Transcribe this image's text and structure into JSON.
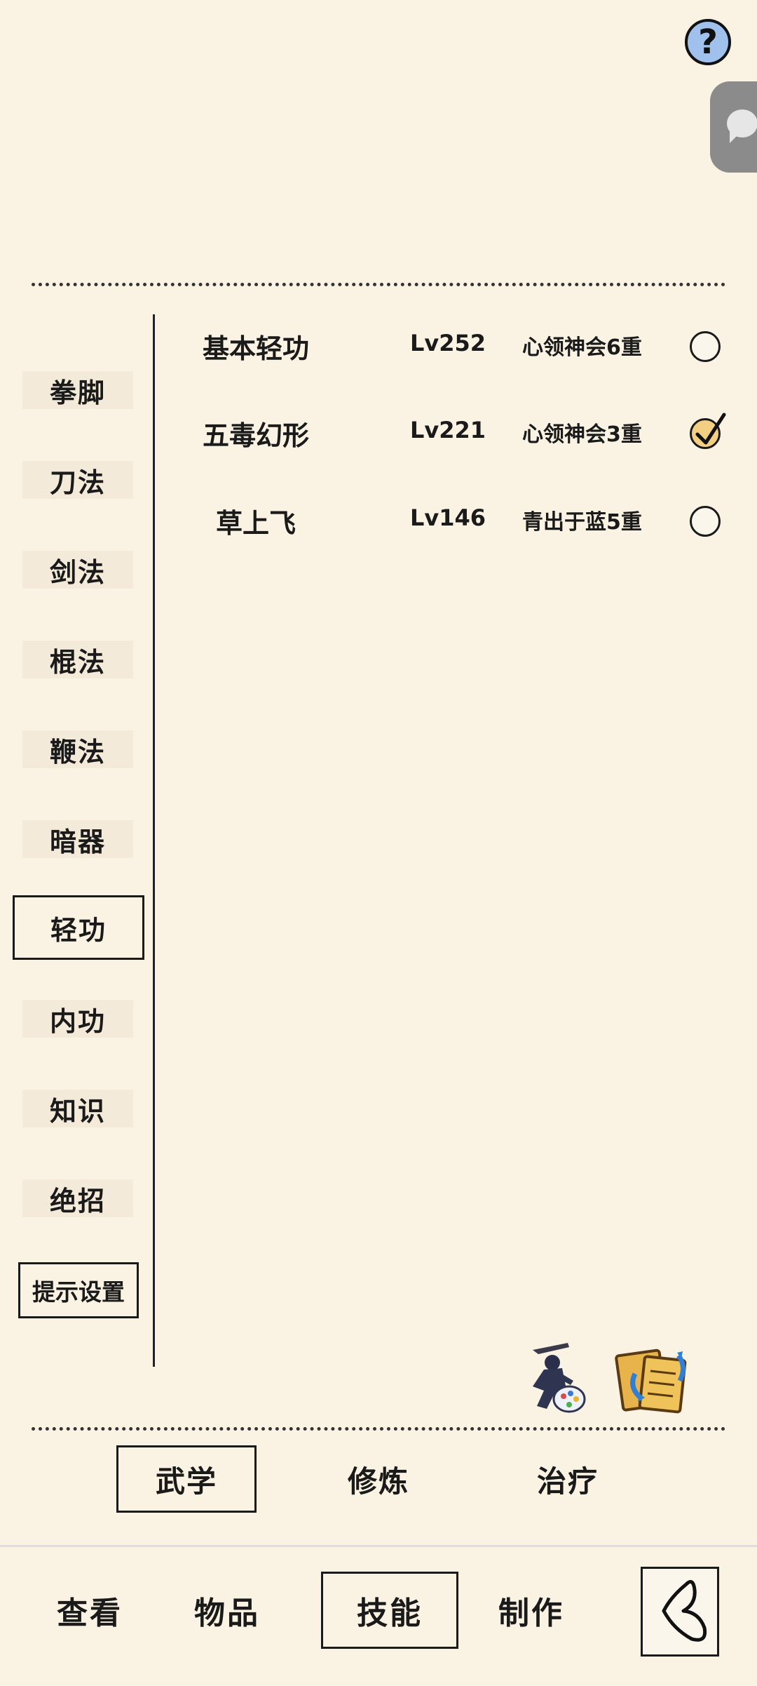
{
  "header": {
    "help_glyph": "?",
    "help_icon": "question-icon",
    "chat_icon": "chat-bubble-icon"
  },
  "categories": [
    {
      "label": "拳脚",
      "active": false
    },
    {
      "label": "刀法",
      "active": false
    },
    {
      "label": "剑法",
      "active": false
    },
    {
      "label": "棍法",
      "active": false
    },
    {
      "label": "鞭法",
      "active": false
    },
    {
      "label": "暗器",
      "active": false
    },
    {
      "label": "轻功",
      "active": true
    },
    {
      "label": "内功",
      "active": false
    },
    {
      "label": "知识",
      "active": false
    },
    {
      "label": "绝招",
      "active": false
    }
  ],
  "hint_settings_label": "提示设置",
  "skills": [
    {
      "name": "基本轻功",
      "level": "Lv252",
      "realm": "心领神会6重",
      "checked": false
    },
    {
      "name": "五毒幻形",
      "level": "Lv221",
      "realm": "心领神会3重",
      "checked": true
    },
    {
      "name": "草上飞",
      "level": "Lv146",
      "realm": "青出于蓝5重",
      "checked": false
    }
  ],
  "action_icons": [
    "ninja-palette-icon",
    "scroll-swap-icon"
  ],
  "sub_tabs": [
    {
      "label": "武学",
      "active": true
    },
    {
      "label": "修炼",
      "active": false
    },
    {
      "label": "治疗",
      "active": false
    }
  ],
  "nav_tabs": [
    {
      "label": "查看",
      "active": false
    },
    {
      "label": "物品",
      "active": false
    },
    {
      "label": "技能",
      "active": true
    },
    {
      "label": "制作",
      "active": false
    }
  ],
  "back_icon": "back-arrow-icon",
  "colors": {
    "background": "#faf2e2",
    "check_fill": "#f2cf83",
    "help_fill": "#9fc1ec"
  }
}
